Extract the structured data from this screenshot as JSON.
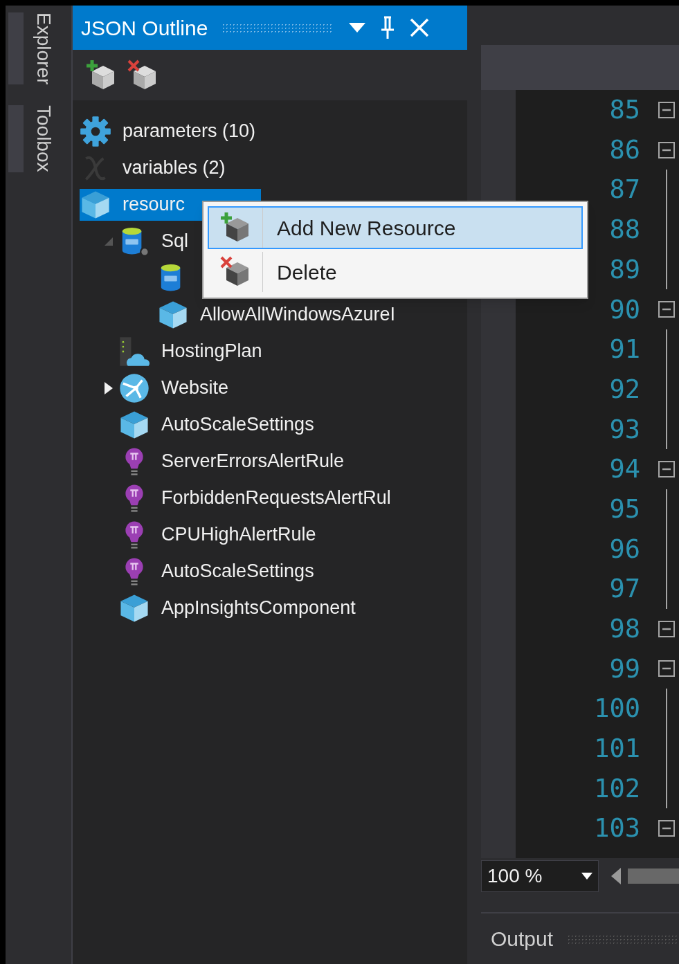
{
  "side_tabs": [
    {
      "label": "Explorer"
    },
    {
      "label": "Toolbox"
    }
  ],
  "panel": {
    "title": "JSON Outline"
  },
  "tree": [
    {
      "kind": "gear",
      "label": "parameters (10)",
      "selected": false
    },
    {
      "kind": "variable",
      "label": "variables (2)",
      "selected": false
    },
    {
      "kind": "cube",
      "label": "resourc",
      "selected": true,
      "children": [
        {
          "kind": "sql-server",
          "label": "Sql",
          "selected": false,
          "expanded": true,
          "children": [
            {
              "kind": "sql-db",
              "selected": false
            },
            {
              "kind": "cube",
              "label": "AllowAllWindowsAzureI",
              "selected": false
            }
          ]
        },
        {
          "kind": "hosting",
          "label": "HostingPlan",
          "selected": false
        },
        {
          "kind": "website",
          "label": "Website",
          "selected": false,
          "expanded": false
        },
        {
          "kind": "cube",
          "label": "AutoScaleSettings",
          "selected": false
        },
        {
          "kind": "bulb",
          "label": "ServerErrorsAlertRule",
          "selected": false
        },
        {
          "kind": "bulb",
          "label": "ForbiddenRequestsAlertRul",
          "selected": false
        },
        {
          "kind": "bulb",
          "label": "CPUHighAlertRule",
          "selected": false
        },
        {
          "kind": "bulb",
          "label": "AutoScaleSettings",
          "selected": false
        },
        {
          "kind": "cube",
          "label": "AppInsightsComponent",
          "selected": false
        }
      ]
    }
  ],
  "context_menu": [
    {
      "kind": "add",
      "label": "Add New Resource",
      "selected": true
    },
    {
      "kind": "delete",
      "label": "Delete",
      "selected": false
    }
  ],
  "editor": {
    "lines": [
      {
        "number": "85",
        "foldable": true
      },
      {
        "number": "86",
        "foldable": true
      },
      {
        "number": "87",
        "foldable": false
      },
      {
        "number": "88",
        "foldable": false
      },
      {
        "number": "89",
        "foldable": false
      },
      {
        "number": "90",
        "foldable": true
      },
      {
        "number": "91",
        "foldable": false
      },
      {
        "number": "92",
        "foldable": false
      },
      {
        "number": "93",
        "foldable": false
      },
      {
        "number": "94",
        "foldable": true
      },
      {
        "number": "95",
        "foldable": false
      },
      {
        "number": "96",
        "foldable": false
      },
      {
        "number": "97",
        "foldable": false
      },
      {
        "number": "98",
        "foldable": true
      },
      {
        "number": "99",
        "foldable": true
      },
      {
        "number": "100",
        "foldable": false
      },
      {
        "number": "101",
        "foldable": false
      },
      {
        "number": "102",
        "foldable": false
      },
      {
        "number": "103",
        "foldable": true
      }
    ],
    "zoom": "100 %"
  },
  "output": {
    "title": "Output"
  }
}
